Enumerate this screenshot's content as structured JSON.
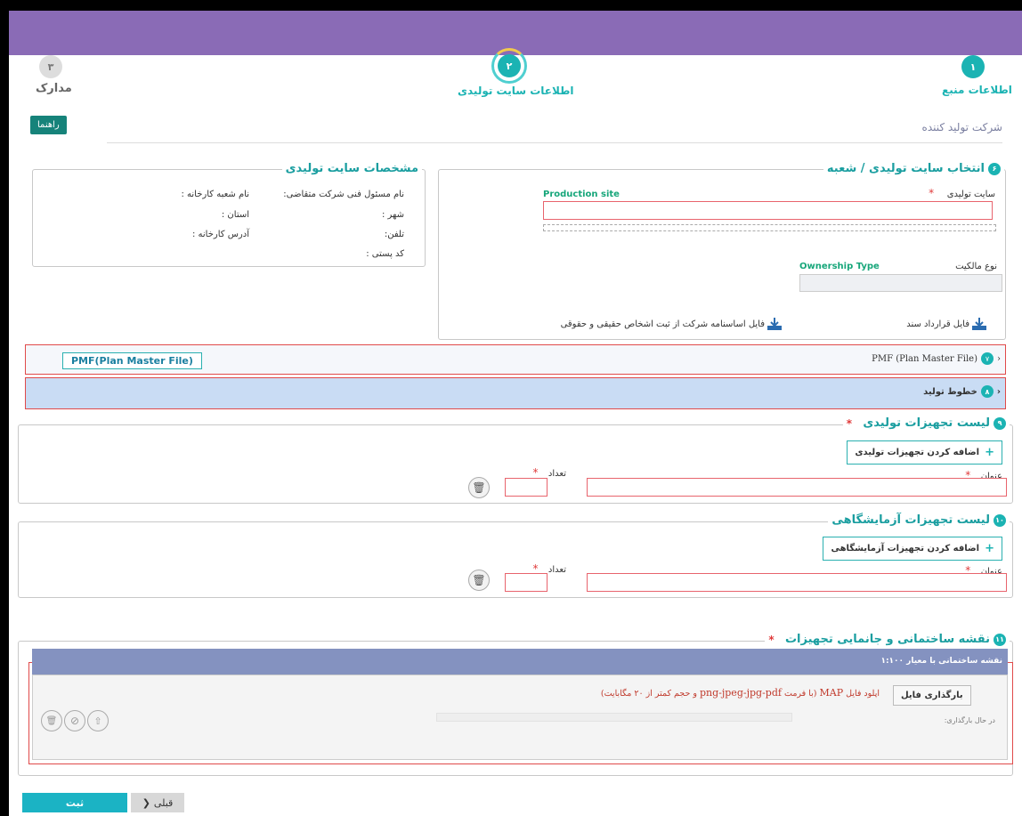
{
  "steps": [
    {
      "number": "۱",
      "label": "اطلاعات منبع"
    },
    {
      "number": "۲",
      "label": "اطلاعات سایت تولیدی"
    },
    {
      "number": "۳",
      "label": "مدارک"
    }
  ],
  "guide_button": "راهنما",
  "section_title": "شرکت تولید کننده",
  "site_select": {
    "number": "۶",
    "title": "انتخاب سایت تولیدی / شعبه",
    "site_label": "سایت تولیدی",
    "site_hint": "Production site",
    "ownership_label": "نوع مالکیت",
    "ownership_hint": "Ownership Type",
    "contract_file": "فایل قرارداد سند",
    "charter_file": "فایل اساسنامه شرکت از ثبت اشخاص حقیقی و حقوقی"
  },
  "site_specs": {
    "title": "مشخصات سایت تولیدی",
    "responsible": "نام مسئول فنی شرکت متقاضی:",
    "branch_name": "نام شعبه کارخانه :",
    "city": "شهر :",
    "province": "استان :",
    "phone": "تلفن:",
    "address": "آدرس کارخانه :",
    "postal": "کد پستی :"
  },
  "pmf": {
    "number": "۷",
    "title": "PMF (Plan Master File)",
    "button": "PMF(Plan Master File)"
  },
  "lines": {
    "number": "۸",
    "title": "خطوط تولید"
  },
  "production_equipment": {
    "number": "۹",
    "title": "لیست تجهیزات تولیدی",
    "add": "اضافه کردن تجهیزات تولیدی",
    "title_label": "عنوان",
    "count_label": "تعداد"
  },
  "lab_equipment": {
    "number": "۱۰",
    "title": "لیست تجهیزات آزمایشگاهی",
    "add": "اضافه کردن تجهیزات آزمایشگاهی",
    "title_label": "عنوان",
    "count_label": "تعداد"
  },
  "map": {
    "number": "۱۱",
    "title": "نقشه ساختمانی و جانمایی تجهیزات",
    "panel_title": "نقشه ساختمانی با معیار ۱:۱۰۰",
    "upload_button": "بارگذاری فایل",
    "upload_prefix": "اپلود فایل",
    "upload_map": "MAP",
    "upload_format_open": "(با فرمت",
    "upload_format": "png-jpeg-jpg-pdf",
    "upload_size": "و حجم کمتر از ۲۰ مگابایت)",
    "status": "در حال بارگذاری:"
  },
  "footer": {
    "submit": "ثبت",
    "previous": "قبلی"
  },
  "colors": {
    "header": "#8a6bb6",
    "teal": "#1bb3b3",
    "required_border": "#e8646d",
    "panel_header": "#8492c0"
  }
}
